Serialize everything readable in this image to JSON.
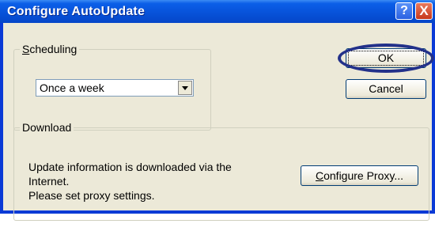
{
  "window": {
    "title": "Configure AutoUpdate",
    "help_glyph": "?",
    "close_glyph": "X",
    "colors": {
      "titlebar": "#0751d8",
      "client": "#ece9d8",
      "highlight_ring": "#23318a"
    }
  },
  "scheduling": {
    "group_label_hotkey": "S",
    "group_label_rest": "cheduling",
    "selected_value": "Once a week"
  },
  "buttons": {
    "ok_label": "OK",
    "cancel_label": "Cancel",
    "proxy_hotkey": "C",
    "proxy_rest": "onfigure Proxy..."
  },
  "download": {
    "group_label": "Download",
    "line1": "Update information is downloaded via the",
    "line2": "Internet.",
    "line3": "Please set proxy settings."
  },
  "icons": {
    "dropdown": "chevron-down-icon",
    "help": "help-icon",
    "close": "close-icon"
  }
}
